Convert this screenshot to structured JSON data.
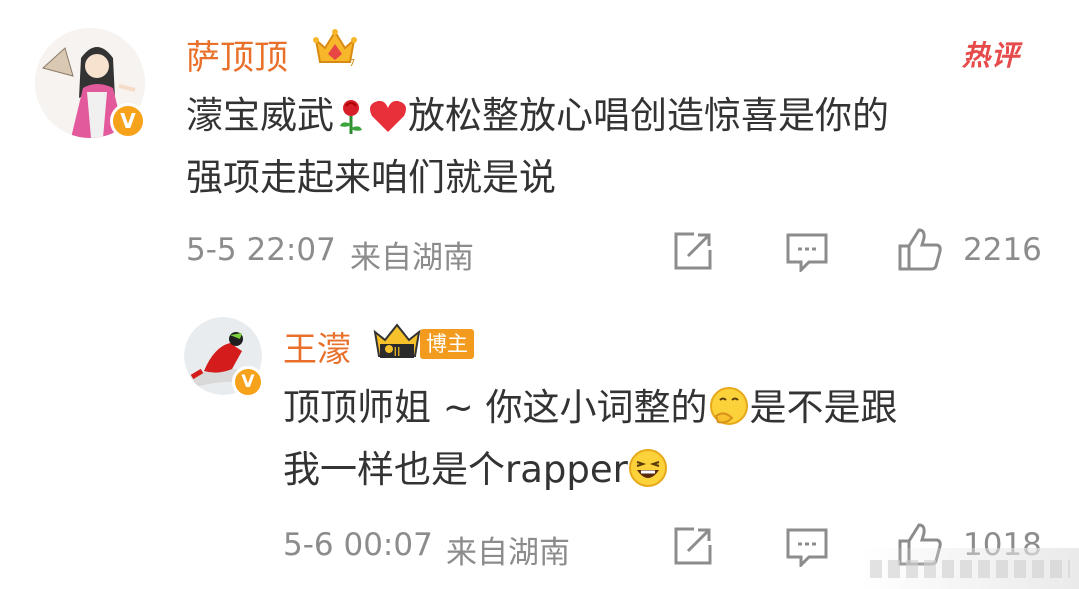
{
  "comment": {
    "username": "萨顶顶",
    "tag": "热评",
    "text_part1": "濛宝威武",
    "text_part2": "放松整放心唱创造惊喜是你的",
    "text_line2": "强项走起来咱们就是说",
    "time": "5-5 22:07",
    "location": "来自湖南",
    "likes": "2216",
    "icons": [
      "share-icon",
      "comment-icon",
      "like-icon",
      "rose-emoji",
      "heart-emoji",
      "crown-badge-icon",
      "verified-badge"
    ],
    "colors": {
      "name": "#e8702a",
      "hot": "#e64a4a",
      "badge": "#f7a21b"
    }
  },
  "reply": {
    "username": "王濛",
    "badge_label": "博主",
    "text_part1": "顶顶师姐 ~ 你这小词整的",
    "text_part2": "是不是跟",
    "text_line2_part1": "我一样也是个rapper",
    "time": "5-6 00:07",
    "location": "来自湖南",
    "likes": "1018",
    "icons": [
      "share-icon",
      "comment-icon",
      "like-icon",
      "thinking-emoji",
      "laughing-emoji",
      "crown-level-icon",
      "verified-badge"
    ]
  }
}
